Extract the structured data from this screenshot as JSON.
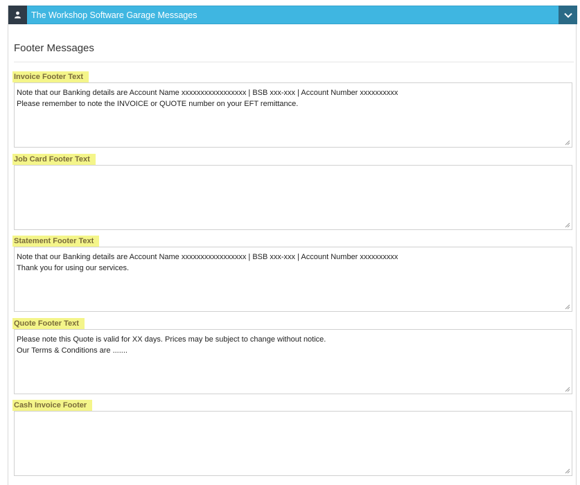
{
  "header": {
    "title": "The Workshop Software Garage Messages",
    "user_icon": "user-icon",
    "collapse_icon": "chevron-down-icon",
    "bg_color": "#3fb6e1"
  },
  "section": {
    "title": "Footer Messages"
  },
  "fields": [
    {
      "label": "Invoice Footer Text",
      "lines": [
        "Note that our Banking details are Account Name xxxxxxxxxxxxxxxxx | BSB xxx-xxx | Account Number xxxxxxxxxx",
        "Please remember to note the INVOICE or QUOTE number on your EFT remittance."
      ]
    },
    {
      "label": "Job Card Footer Text",
      "lines": []
    },
    {
      "label": "Statement Footer Text",
      "lines": [
        "Note that our Banking details are Account Name xxxxxxxxxxxxxxxxx | BSB xxx-xxx | Account Number xxxxxxxxxx",
        "Thank you for using our services."
      ]
    },
    {
      "label": "Quote Footer Text",
      "lines": [
        "Please note this Quote is valid for XX days. Prices may be subject to change without notice.",
        "Our Terms & Conditions are ......."
      ]
    },
    {
      "label": "Cash Invoice Footer",
      "lines": []
    }
  ]
}
